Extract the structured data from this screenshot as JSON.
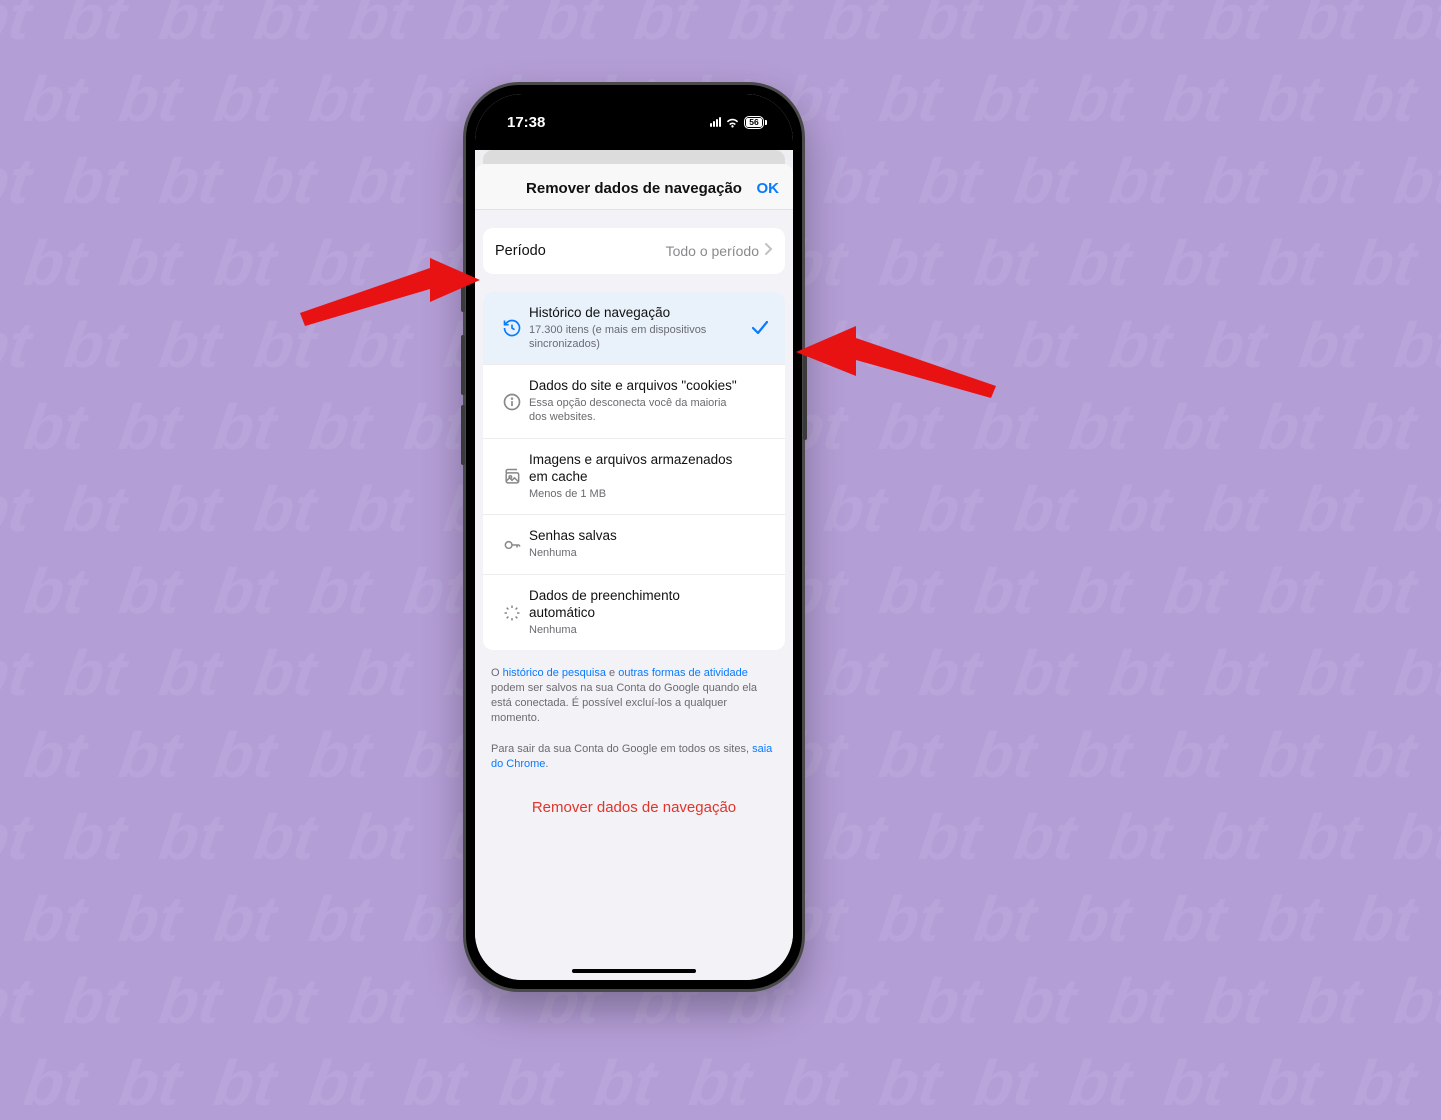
{
  "statusbar": {
    "time": "17:38",
    "battery": "56"
  },
  "nav": {
    "title": "Remover dados de navegação",
    "ok": "OK"
  },
  "period": {
    "label": "Período",
    "value": "Todo o período"
  },
  "options": {
    "history": {
      "title": "Histórico de navegação",
      "subtitle": "17.300 itens (e mais em dispositivos sincronizados)",
      "checked": true
    },
    "cookies": {
      "title": "Dados do site e arquivos \"cookies\"",
      "subtitle": "Essa opção desconecta você da maioria dos websites."
    },
    "cache": {
      "title": "Imagens e arquivos armazenados em cache",
      "subtitle": "Menos de 1 MB"
    },
    "passwords": {
      "title": "Senhas salvas",
      "subtitle": "Nenhuma"
    },
    "autofill": {
      "title": "Dados de preenchimento automático",
      "subtitle": "Nenhuma"
    }
  },
  "footer": {
    "p1_pre": "O ",
    "p1_link1": "histórico de pesquisa",
    "p1_mid": " e ",
    "p1_link2": "outras formas de atividade",
    "p1_post": " podem ser salvos na sua Conta do Google quando ela está conectada. É possível excluí-los a qualquer momento.",
    "p2_pre": "Para sair da sua Conta do Google em todos os sites, ",
    "p2_link": "saia do Chrome",
    "p2_post": "."
  },
  "actions": {
    "remove": "Remover dados de navegação"
  }
}
